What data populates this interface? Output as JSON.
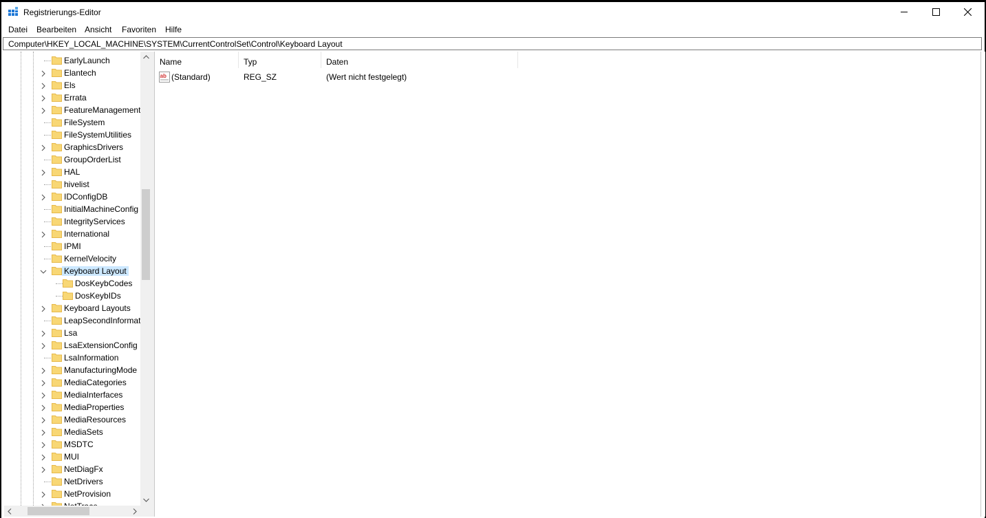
{
  "window": {
    "title": "Registrierungs-Editor",
    "minimize_icon": "minimize-icon",
    "maximize_icon": "maximize-icon",
    "close_icon": "close-icon"
  },
  "menu": [
    "Datei",
    "Bearbeiten",
    "Ansicht",
    "Favoriten",
    "Hilfe"
  ],
  "address": "Computer\\HKEY_LOCAL_MACHINE\\SYSTEM\\CurrentControlSet\\Control\\Keyboard Layout",
  "tree": {
    "items": [
      {
        "label": "EarlyLaunch",
        "expandable": false,
        "level": 0
      },
      {
        "label": "Elantech",
        "expandable": true,
        "level": 0
      },
      {
        "label": "Els",
        "expandable": true,
        "level": 0
      },
      {
        "label": "Errata",
        "expandable": true,
        "level": 0
      },
      {
        "label": "FeatureManagement",
        "expandable": true,
        "level": 0
      },
      {
        "label": "FileSystem",
        "expandable": false,
        "level": 0
      },
      {
        "label": "FileSystemUtilities",
        "expandable": false,
        "level": 0
      },
      {
        "label": "GraphicsDrivers",
        "expandable": true,
        "level": 0
      },
      {
        "label": "GroupOrderList",
        "expandable": false,
        "level": 0
      },
      {
        "label": "HAL",
        "expandable": true,
        "level": 0
      },
      {
        "label": "hivelist",
        "expandable": false,
        "level": 0
      },
      {
        "label": "IDConfigDB",
        "expandable": true,
        "level": 0
      },
      {
        "label": "InitialMachineConfig",
        "expandable": false,
        "level": 0
      },
      {
        "label": "IntegrityServices",
        "expandable": false,
        "level": 0
      },
      {
        "label": "International",
        "expandable": true,
        "level": 0
      },
      {
        "label": "IPMI",
        "expandable": false,
        "level": 0
      },
      {
        "label": "KernelVelocity",
        "expandable": false,
        "level": 0
      },
      {
        "label": "Keyboard Layout",
        "expandable": true,
        "expanded": true,
        "selected": true,
        "level": 0
      },
      {
        "label": "DosKeybCodes",
        "expandable": false,
        "level": 1
      },
      {
        "label": "DosKeybIDs",
        "expandable": false,
        "level": 1
      },
      {
        "label": "Keyboard Layouts",
        "expandable": true,
        "level": 0
      },
      {
        "label": "LeapSecondInformat",
        "expandable": false,
        "level": 0
      },
      {
        "label": "Lsa",
        "expandable": true,
        "level": 0
      },
      {
        "label": "LsaExtensionConfig",
        "expandable": true,
        "level": 0
      },
      {
        "label": "LsaInformation",
        "expandable": false,
        "level": 0
      },
      {
        "label": "ManufacturingMode",
        "expandable": true,
        "level": 0
      },
      {
        "label": "MediaCategories",
        "expandable": true,
        "level": 0
      },
      {
        "label": "MediaInterfaces",
        "expandable": true,
        "level": 0
      },
      {
        "label": "MediaProperties",
        "expandable": true,
        "level": 0
      },
      {
        "label": "MediaResources",
        "expandable": true,
        "level": 0
      },
      {
        "label": "MediaSets",
        "expandable": true,
        "level": 0
      },
      {
        "label": "MSDTC",
        "expandable": true,
        "level": 0
      },
      {
        "label": "MUI",
        "expandable": true,
        "level": 0
      },
      {
        "label": "NetDiagFx",
        "expandable": true,
        "level": 0
      },
      {
        "label": "NetDrivers",
        "expandable": false,
        "level": 0
      },
      {
        "label": "NetProvision",
        "expandable": true,
        "level": 0
      },
      {
        "label": "NetTrace",
        "expandable": true,
        "level": 0
      }
    ]
  },
  "list": {
    "columns": [
      "Name",
      "Typ",
      "Daten"
    ],
    "rows": [
      {
        "name": "(Standard)",
        "type": "REG_SZ",
        "data": "(Wert nicht festgelegt)",
        "icon": "string-value-icon"
      }
    ]
  },
  "colors": {
    "selection": "#cce8ff",
    "folder": "#f8d775",
    "folder_dark": "#e6b84a"
  }
}
